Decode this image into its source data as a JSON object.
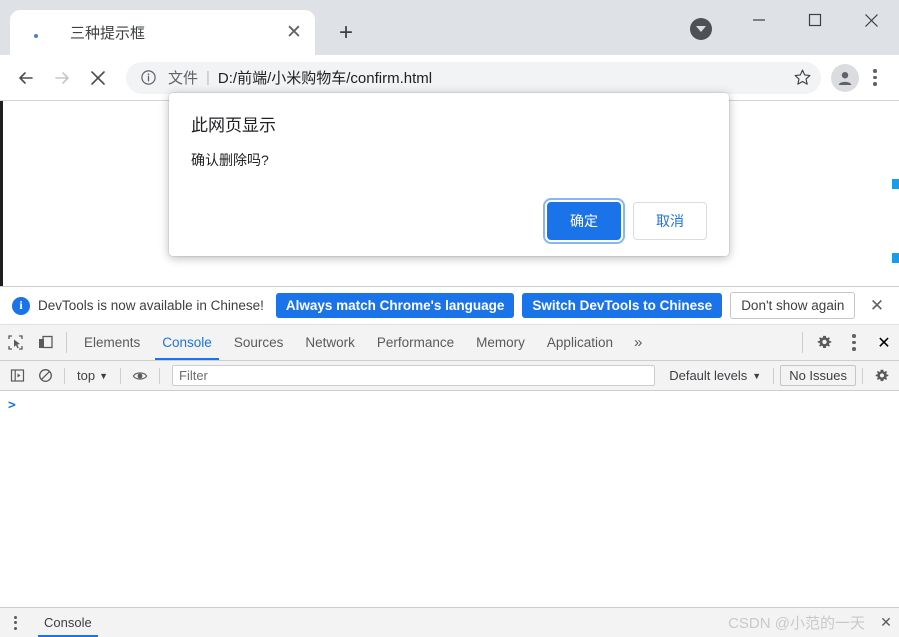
{
  "window": {
    "minimize_label": "—",
    "maximize_label": "□",
    "close_label": "✕",
    "download_indicator": "download-indicator"
  },
  "tabstrip": {
    "tabs": [
      {
        "title": "三种提示框",
        "favicon": "blue-dot-favicon",
        "close_label": "✕"
      }
    ],
    "new_tab_label": "+"
  },
  "toolbar": {
    "back_label": "←",
    "forward_label": "→",
    "stop_label": "✕",
    "omnibox": {
      "info_icon": "info-circle-icon",
      "scheme_label": "文件",
      "separator": "|",
      "url": "D:/前端/小米购物车/confirm.html"
    },
    "star_icon": "star-icon",
    "avatar_icon": "profile-avatar-icon",
    "menu_icon": "three-dot-menu-icon"
  },
  "dialog": {
    "title": "此网页显示",
    "message": "确认删除吗?",
    "confirm_label": "确定",
    "cancel_label": "取消",
    "confirm_color": "#1a73e8",
    "cancel_text_color": "#1a73e8"
  },
  "devtools": {
    "banner": {
      "info_icon": "info-icon",
      "text": "DevTools is now available in Chinese!",
      "primary_button": "Always match Chrome's language",
      "secondary_button": "Switch DevTools to Chinese",
      "tertiary_button": "Don't show again",
      "close_label": "✕",
      "accent_color": "#1a73e8"
    },
    "tabbar": {
      "inspect_icon": "inspect-element-icon",
      "device_icon": "device-toolbar-icon",
      "tabs": [
        {
          "label": "Elements",
          "active": false
        },
        {
          "label": "Console",
          "active": true
        },
        {
          "label": "Sources",
          "active": false
        },
        {
          "label": "Network",
          "active": false
        },
        {
          "label": "Performance",
          "active": false
        },
        {
          "label": "Memory",
          "active": false
        },
        {
          "label": "Application",
          "active": false
        }
      ],
      "more_label": "»",
      "settings_icon": "gear-icon",
      "menu_icon": "three-dot-menu-icon",
      "close_label": "✕",
      "active_tab": "Console",
      "active_color": "#1a73e8"
    },
    "console_toolbar": {
      "sidebar_icon": "console-sidebar-icon",
      "clear_icon": "clear-console-icon",
      "context_label": "top",
      "context_caret": "▼",
      "eye_icon": "live-expression-icon",
      "filter_placeholder": "Filter",
      "filter_value": "",
      "levels_label": "Default levels",
      "levels_caret": "▼",
      "issues_label": "No Issues",
      "settings_icon": "gear-icon"
    },
    "console": {
      "prompt_caret": ">",
      "input_value": "",
      "messages": []
    },
    "drawer": {
      "menu_icon": "three-dot-menu-icon",
      "tab_label": "Console",
      "close_label": "✕"
    }
  },
  "watermark": {
    "text": "CSDN @小范的一天"
  }
}
